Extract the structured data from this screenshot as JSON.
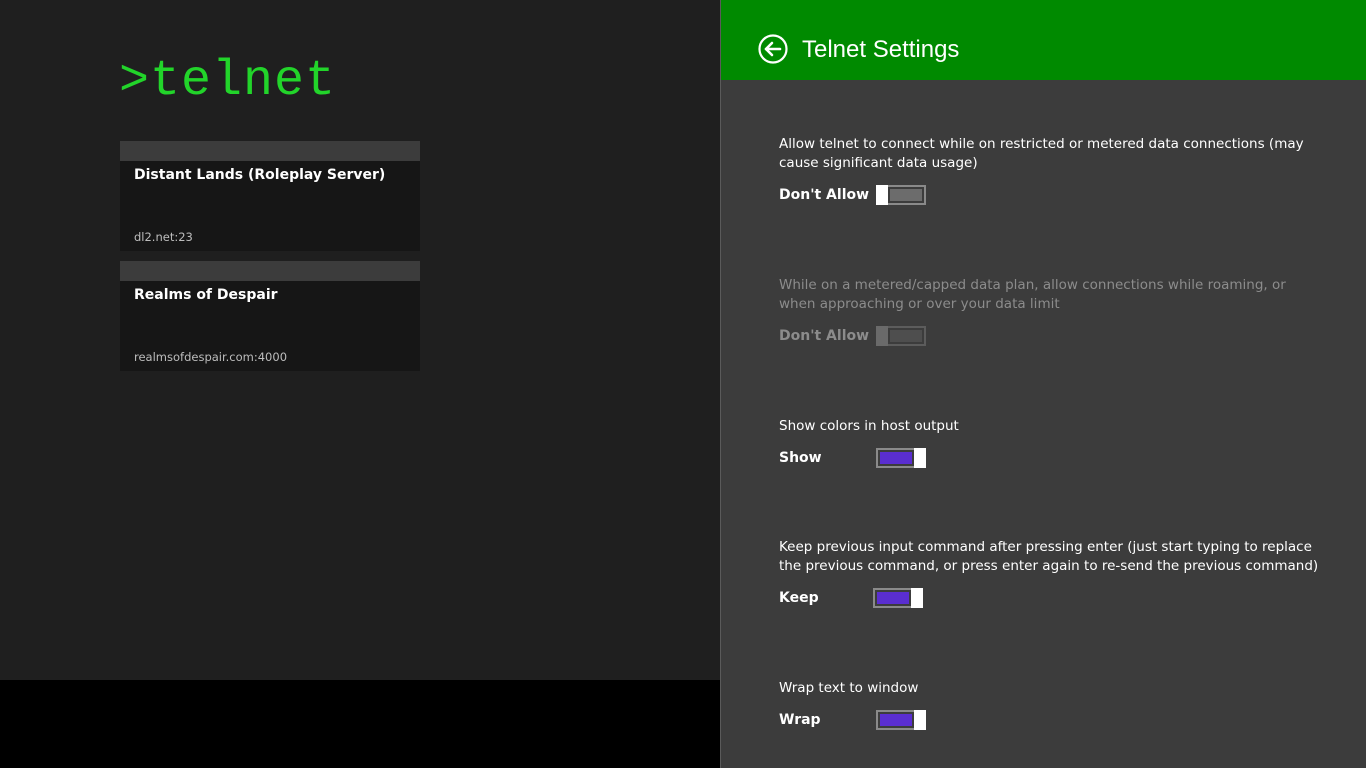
{
  "app": {
    "title": ">telnet"
  },
  "hosts": [
    {
      "name": "Distant Lands (Roleplay Server)",
      "address": "dl2.net:23"
    },
    {
      "name": "Realms of Despair",
      "address": "realmsofdespair.com:4000"
    }
  ],
  "settings": {
    "title": "Telnet Settings",
    "back_icon": "back-arrow-circle-icon",
    "accent_color": "#008a00",
    "toggle_on_color": "#5a2ed0",
    "items": [
      {
        "description": "Allow telnet to connect while on restricted or metered data connections (may cause significant data usage)",
        "state_label": "Don't Allow",
        "on": false,
        "enabled": true
      },
      {
        "description": "While on a metered/capped data plan, allow connections while roaming, or when approaching or over your data limit",
        "state_label": "Don't Allow",
        "on": false,
        "enabled": false
      },
      {
        "description": "Show colors in host output",
        "state_label": "Show",
        "on": true,
        "enabled": true
      },
      {
        "description": "Keep previous input command after pressing enter (just start typing to replace the previous command, or press enter again to re-send the previous command)",
        "state_label": "Keep",
        "on": true,
        "enabled": true
      },
      {
        "description": "Wrap text to window",
        "state_label": "Wrap",
        "on": true,
        "enabled": true
      }
    ]
  }
}
